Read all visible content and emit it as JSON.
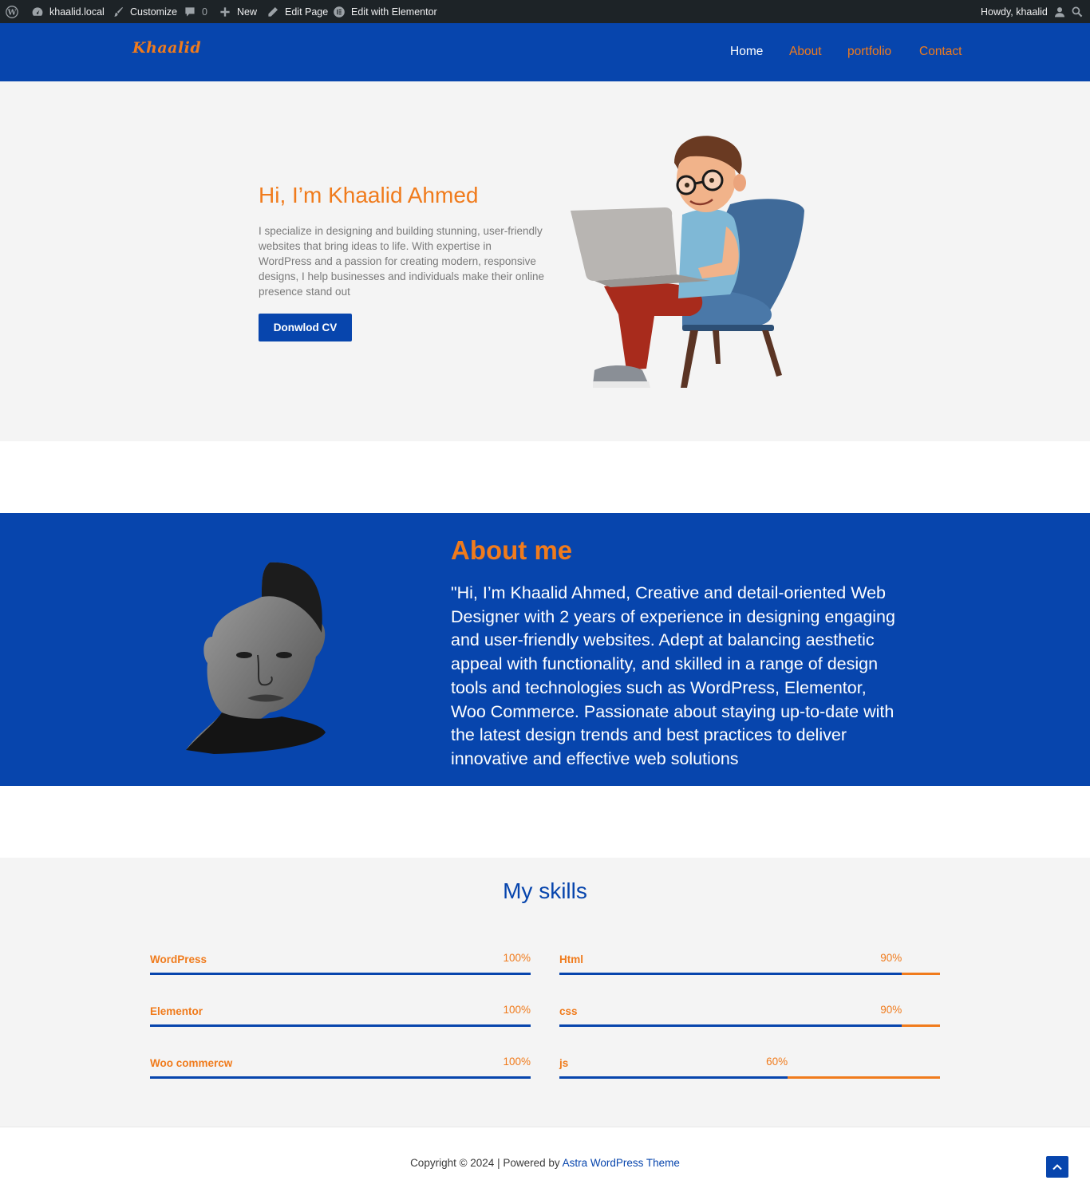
{
  "admin_bar": {
    "site": "khaalid.local",
    "customize": "Customize",
    "comments_count": "0",
    "new": "New",
    "edit_page": "Edit Page",
    "edit_elementor": "Edit with Elementor",
    "howdy": "Howdy, khaalid"
  },
  "header": {
    "logo": "Khaalid",
    "nav": [
      "Home",
      "About",
      "portfolio",
      "Contact"
    ]
  },
  "hero": {
    "title": "Hi, I’m Khaalid Ahmed",
    "text": "I specialize in designing and building stunning, user-friendly websites that bring ideas to life. With expertise in WordPress and a passion for creating modern, responsive designs, I help businesses and individuals make their online presence stand out",
    "button": "Donwlod CV"
  },
  "about": {
    "title": "About me",
    "text": "\"Hi, I’m Khaalid Ahmed, Creative and detail-oriented Web Designer with 2 years of experience in designing engaging and user-friendly websites. Adept at balancing aesthetic appeal with functionality, and skilled in a range of design tools and technologies such as WordPress, Elementor, Woo Commerce. Passionate about staying up-to-date with the latest design trends and best practices to deliver innovative and effective web solutions"
  },
  "skills": {
    "title": "My skills",
    "items": [
      {
        "name": "WordPress",
        "percent_label": "100%",
        "percent": 100
      },
      {
        "name": "Html",
        "percent_label": "90%",
        "percent": 90
      },
      {
        "name": "Elementor",
        "percent_label": "100%",
        "percent": 100
      },
      {
        "name": "css",
        "percent_label": "90%",
        "percent": 90
      },
      {
        "name": "Woo commercw",
        "percent_label": "100%",
        "percent": 100
      },
      {
        "name": "js",
        "percent_label": "60%",
        "percent": 60
      }
    ]
  },
  "footer": {
    "copyright": "Copyright © 2024 | Powered by ",
    "theme_link": "Astra WordPress Theme"
  },
  "colors": {
    "primary_blue": "#0745ad",
    "accent_orange": "#f07b1c",
    "admin_bar": "#1d2327",
    "light_bg": "#f4f4f4"
  },
  "icons": [
    "wordpress-icon",
    "dashboard-icon",
    "brush-icon",
    "comment-icon",
    "plus-icon",
    "pencil-icon",
    "elementor-icon",
    "user-icon",
    "search-icon",
    "arrow-up-icon"
  ]
}
